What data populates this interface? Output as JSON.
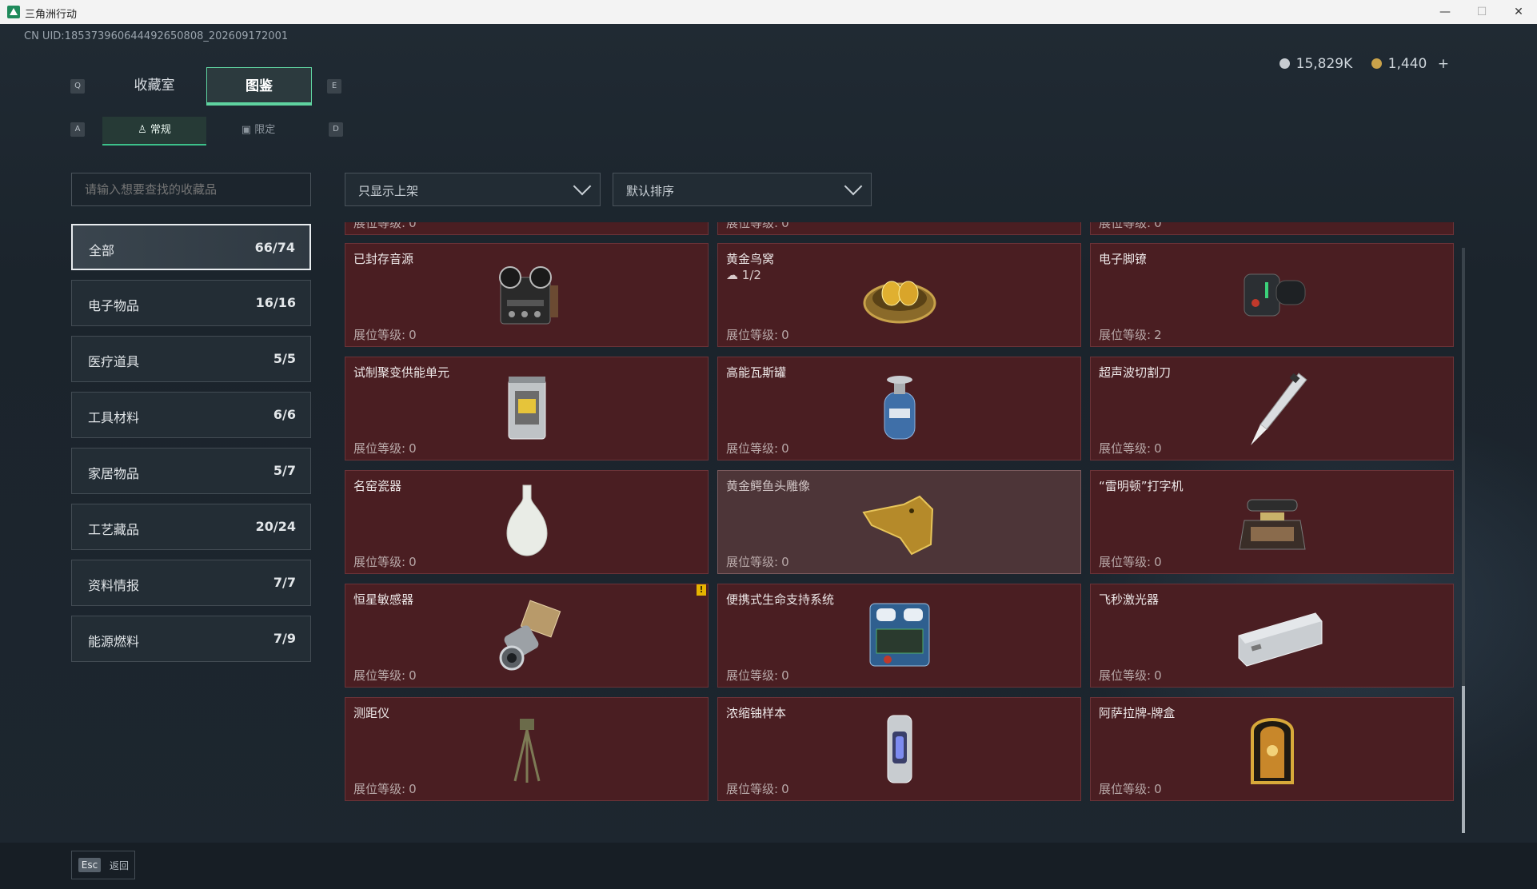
{
  "window": {
    "title": "三角洲行动",
    "minimize": "—",
    "maximize": "☐",
    "close": "✕"
  },
  "uid": "CN UID:185373960644492650808_202609172001",
  "tabs": [
    {
      "key": "Q"
    },
    {
      "label": "收藏室"
    },
    {
      "label": "图鉴"
    },
    {
      "key": "E"
    }
  ],
  "subtabs": {
    "left_key": "A",
    "right_key": "D",
    "items": [
      {
        "label": "常规"
      },
      {
        "label": "限定"
      }
    ]
  },
  "currency": {
    "silver": "15,829K",
    "gold": "1,440",
    "add": "+"
  },
  "search": {
    "placeholder": "请输入想要查找的收藏品"
  },
  "filters": {
    "listed": "只显示上架",
    "sort": "默认排序"
  },
  "categories": [
    {
      "label": "全部",
      "count": "66/74"
    },
    {
      "label": "电子物品",
      "count": "16/16"
    },
    {
      "label": "医疗道具",
      "count": "5/5"
    },
    {
      "label": "工具材料",
      "count": "6/6"
    },
    {
      "label": "家居物品",
      "count": "5/7"
    },
    {
      "label": "工艺藏品",
      "count": "20/24"
    },
    {
      "label": "资料情报",
      "count": "7/7"
    },
    {
      "label": "能源燃料",
      "count": "7/9"
    }
  ],
  "level_label": "展位等级:",
  "items": [
    {
      "name": "",
      "level": "0"
    },
    {
      "name": "",
      "level": "0"
    },
    {
      "name": "",
      "level": "0"
    },
    {
      "name": "已封存音源",
      "level": "0"
    },
    {
      "name": "黄金鸟窝",
      "level": "0",
      "extra": "1/2"
    },
    {
      "name": "电子脚镣",
      "level": "2"
    },
    {
      "name": "试制聚变供能单元",
      "level": "0"
    },
    {
      "name": "高能瓦斯罐",
      "level": "0"
    },
    {
      "name": "超声波切割刀",
      "level": "0"
    },
    {
      "name": "名窑瓷器",
      "level": "0"
    },
    {
      "name": "黄金鳄鱼头雕像",
      "level": "0"
    },
    {
      "name": "“雷明顿”打字机",
      "level": "0"
    },
    {
      "name": "恒星敏感器",
      "level": "0",
      "badge": "!"
    },
    {
      "name": "便携式生命支持系统",
      "level": "0"
    },
    {
      "name": "飞秒激光器",
      "level": "0"
    },
    {
      "name": "测距仪",
      "level": "0"
    },
    {
      "name": "浓缩铀样本",
      "level": "0"
    },
    {
      "name": "阿萨拉牌-牌盒",
      "level": "0"
    }
  ],
  "footer": {
    "esc_key": "Esc",
    "esc_label": "返回"
  }
}
